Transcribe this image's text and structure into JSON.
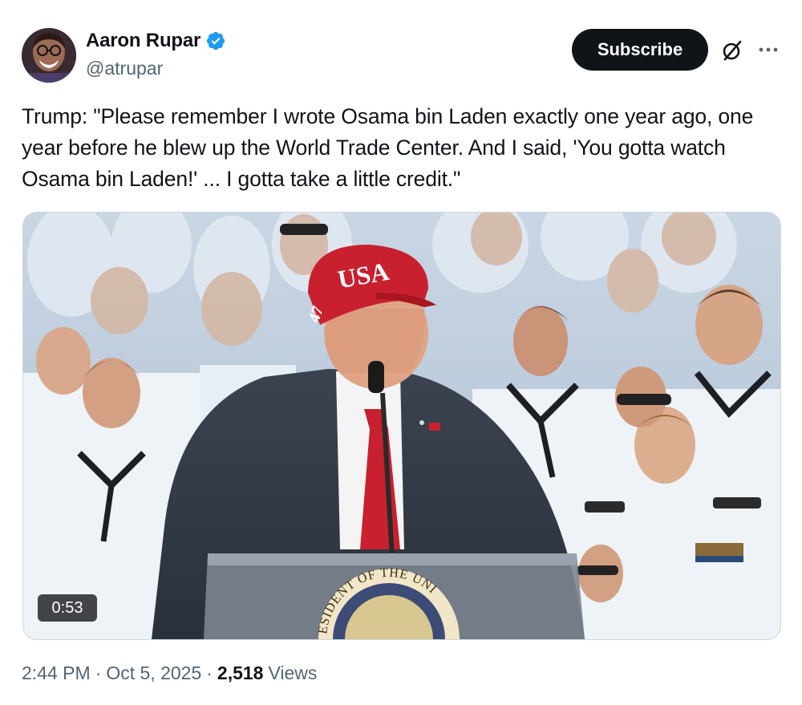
{
  "author": {
    "display_name": "Aaron Rupar",
    "handle": "@atrupar",
    "verified_icon": "verified-badge-icon",
    "avatar_icon": "avatar"
  },
  "header": {
    "subscribe_label": "Subscribe",
    "grok_icon": "grok-icon",
    "more_icon": "more-options-icon"
  },
  "tweet": {
    "text": "Trump: \"Please remember I wrote Osama bin Laden exactly one year ago, one year before he blew up the World Trade Center. And I said, 'You gotta watch Osama bin Laden!' ... I gotta take a little credit.\""
  },
  "media": {
    "duration": "0:53",
    "cap_text": "USA",
    "cap_side_text": "47",
    "seal_text": "ESIDENT OF THE UNI"
  },
  "meta": {
    "time": "2:44 PM",
    "date": "Oct 5, 2025",
    "separator": "·",
    "views_count": "2,518",
    "views_label": "Views"
  },
  "colors": {
    "text_primary": "#0f1419",
    "text_secondary": "#536471",
    "verified_blue": "#1d9bf0",
    "button_bg": "#0f1419",
    "cap_red": "#c8202e",
    "tie_red": "#c8202e"
  }
}
